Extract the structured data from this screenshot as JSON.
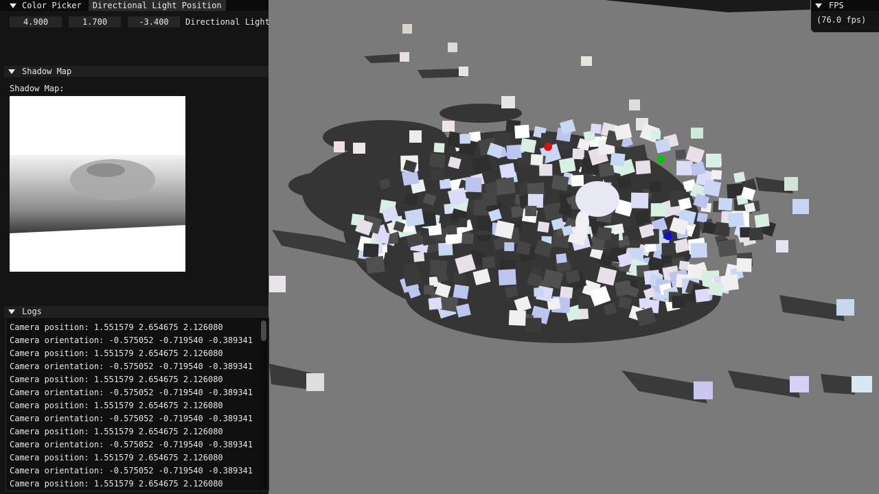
{
  "light_window": {
    "tabs": [
      "Color Picker",
      "Directional Light Position"
    ],
    "x_value": "4.900",
    "y_value": "1.700",
    "z_value": "-3.400",
    "field_label": "Directional Light"
  },
  "shadow_section": {
    "header": "Shadow Map",
    "label": "Shadow Map:"
  },
  "logs_section": {
    "header": "Logs",
    "lines": [
      "Camera position: 1.551579 2.654675 2.126080",
      "Camera orientation: -0.575052 -0.719540 -0.389341",
      "Camera position: 1.551579 2.654675 2.126080",
      "Camera orientation: -0.575052 -0.719540 -0.389341",
      "Camera position: 1.551579 2.654675 2.126080",
      "Camera orientation: -0.575052 -0.719540 -0.389341",
      "Camera position: 1.551579 2.654675 2.126080",
      "Camera orientation: -0.575052 -0.719540 -0.389341",
      "Camera position: 1.551579 2.654675 2.126080",
      "Camera orientation: -0.575052 -0.719540 -0.389341",
      "Camera position: 1.551579 2.654675 2.126080",
      "Camera orientation: -0.575052 -0.719540 -0.389341",
      "Camera position: 1.551579 2.654675 2.126080"
    ]
  },
  "fps_window": {
    "title": "FPS",
    "value": "(76.0 fps)"
  },
  "colors": {
    "floor": "#7a7a7a",
    "panel": "#141414",
    "titlebar": "#0b0b0b",
    "marker_red": "#e01010",
    "marker_green": "#10c010",
    "marker_blue": "#1010d0"
  },
  "icons": [
    "collapse-arrow-icon",
    "scrollbar-thumb"
  ]
}
